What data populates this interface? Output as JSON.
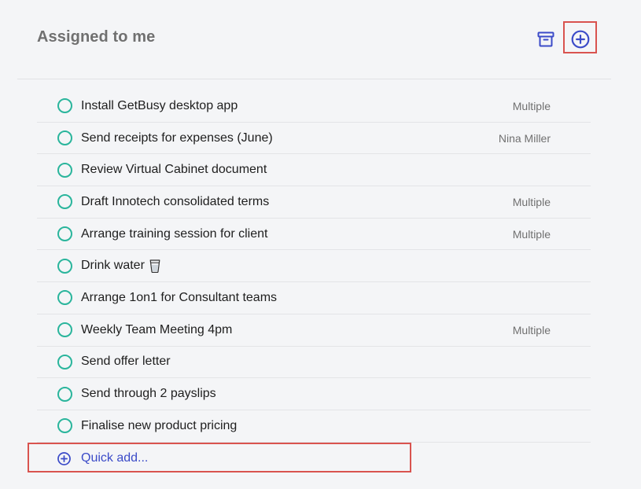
{
  "header": {
    "title": "Assigned to me",
    "archive_icon": "archive-icon",
    "add_icon": "add-circle-icon"
  },
  "colors": {
    "accent": "#3b4bc8",
    "check_ring": "#2ab59c",
    "highlight": "#d9534f",
    "title_gray": "#707070",
    "background": "#f4f5f7"
  },
  "tasks": [
    {
      "title": "Install GetBusy desktop app",
      "assignee": "Multiple"
    },
    {
      "title": "Send receipts for expenses (June)",
      "assignee": "Nina Miller"
    },
    {
      "title": "Review Virtual Cabinet document",
      "assignee": ""
    },
    {
      "title": "Draft Innotech consolidated terms",
      "assignee": "Multiple"
    },
    {
      "title": "Arrange training session for client",
      "assignee": "Multiple"
    },
    {
      "title": "Drink water",
      "assignee": "",
      "icon": "cup-icon"
    },
    {
      "title": "Arrange 1on1 for Consultant teams",
      "assignee": ""
    },
    {
      "title": "Weekly Team Meeting 4pm",
      "assignee": "Multiple"
    },
    {
      "title": "Send offer letter",
      "assignee": ""
    },
    {
      "title": "Send through 2 payslips",
      "assignee": ""
    },
    {
      "title": "Finalise new product pricing",
      "assignee": ""
    }
  ],
  "quick_add": {
    "label": "Quick add...",
    "icon": "add-circle-icon"
  }
}
